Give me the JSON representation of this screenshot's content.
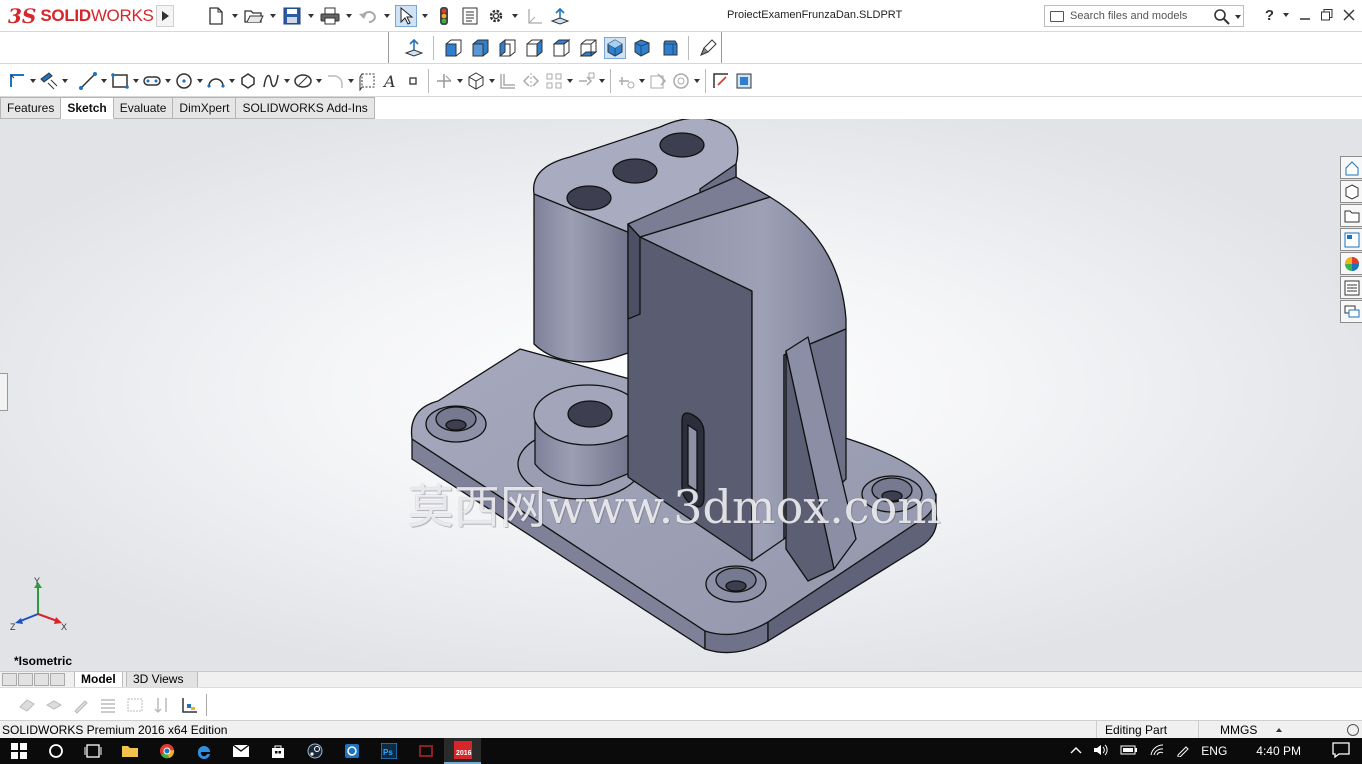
{
  "app": {
    "logo_prefix": "3S",
    "logo_text_bold": "SOLID",
    "logo_text_light": "WORKS",
    "document_title": "ProiectExamenFrunzaDan.SLDPRT"
  },
  "search": {
    "placeholder": "Search files and models"
  },
  "help_label": "?",
  "command_tabs": [
    {
      "label": "Features"
    },
    {
      "label": "Sketch"
    },
    {
      "label": "Evaluate"
    },
    {
      "label": "DimXpert"
    },
    {
      "label": "SOLIDWORKS Add-Ins"
    }
  ],
  "viewport": {
    "watermark": "莫西网www.3dmox.com",
    "view_name": "*Isometric",
    "triad": {
      "x": "X",
      "y": "Y",
      "z": "Z"
    }
  },
  "model_tabs": {
    "model": "Model",
    "views3d": "3D Views"
  },
  "status": {
    "app_edition": "SOLIDWORKS Premium 2016 x64 Edition",
    "mode": "Editing Part",
    "units": "MMGS"
  },
  "taskbar": {
    "language": "ENG",
    "time": "4:40 PM",
    "solidworks_badge": "2016"
  },
  "colors": {
    "brand_red": "#d7262a",
    "model_face": "#8b8ea4",
    "model_face_dark": "#5a5d72",
    "model_face_light": "#a9acbf",
    "accent_blue": "#1e73be",
    "taskbar": "#0b0b0b"
  }
}
